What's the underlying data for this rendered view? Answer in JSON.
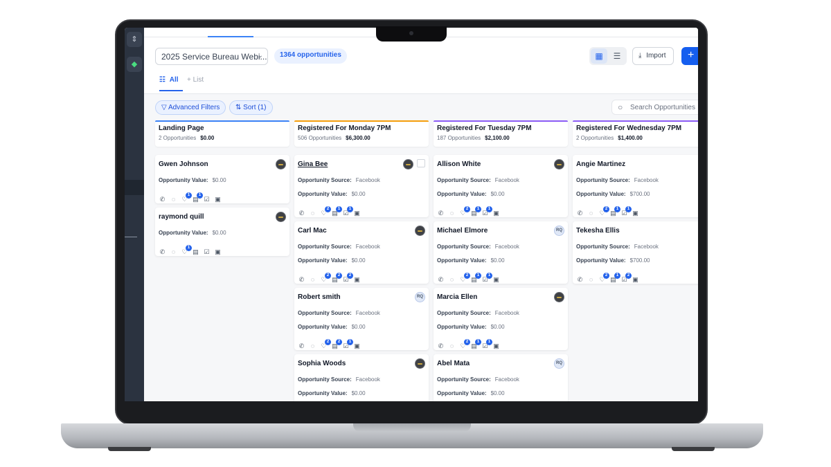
{
  "header": {
    "pipeline": "2025 Service Bureau Webi...",
    "opportunity_count": "1364 opportunities",
    "import_label": "Import",
    "add_label": "+"
  },
  "tabs": {
    "all": "All",
    "list": "+ List"
  },
  "filters": {
    "advanced": "Advanced Filters",
    "sort": "Sort (1)"
  },
  "search": {
    "placeholder": "Search Opportunities"
  },
  "labels": {
    "source": "Opportunity Source:",
    "value": "Opportunity Value:"
  },
  "columns": [
    {
      "title": "Landing Page",
      "count": "2 Opportunities",
      "amount": "$0.00",
      "accent": "#3b82f6"
    },
    {
      "title": "Registered For Monday 7PM",
      "count": "506 Opportunities",
      "amount": "$6,300.00",
      "accent": "#f59e0b"
    },
    {
      "title": "Registered For Tuesday 7PM",
      "count": "187 Opportunities",
      "amount": "$2,100.00",
      "accent": "#8b5cf6"
    },
    {
      "title": "Registered For Wednesday 7PM",
      "count": "2 Opportunities",
      "amount": "$1,400.00",
      "accent": "#8b5cf6"
    }
  ],
  "cards": {
    "c0": [
      {
        "name": "Gwen Johnson",
        "value": "$0.00"
      },
      {
        "name": "raymond quill",
        "value": "$0.00"
      }
    ],
    "c1": [
      {
        "name": "Gina Bee",
        "source": "Facebook",
        "value": "$0.00"
      },
      {
        "name": "Carl Mac",
        "source": "Facebook",
        "value": "$0.00"
      },
      {
        "name": "Robert smith",
        "source": "Facebook",
        "value": "$0.00"
      },
      {
        "name": "Sophia Woods",
        "source": "Facebook",
        "value": "$0.00"
      }
    ],
    "c2": [
      {
        "name": "Allison White",
        "source": "Facebook",
        "value": "$0.00"
      },
      {
        "name": "Michael Elmore",
        "source": "Facebook",
        "value": "$0.00"
      },
      {
        "name": "Marcia Ellen",
        "source": "Facebook",
        "value": "$0.00"
      },
      {
        "name": "Abel Mata",
        "source": "Facebook",
        "value": "$0.00"
      }
    ],
    "c3": [
      {
        "name": "Angie Martinez",
        "source": "Facebook",
        "value": "$700.00"
      },
      {
        "name": "Tekesha Ellis",
        "source": "Facebook",
        "value": "$700.00"
      }
    ]
  },
  "avatar_initials": "RQ",
  "badges": {
    "one": "1",
    "two": "2"
  }
}
